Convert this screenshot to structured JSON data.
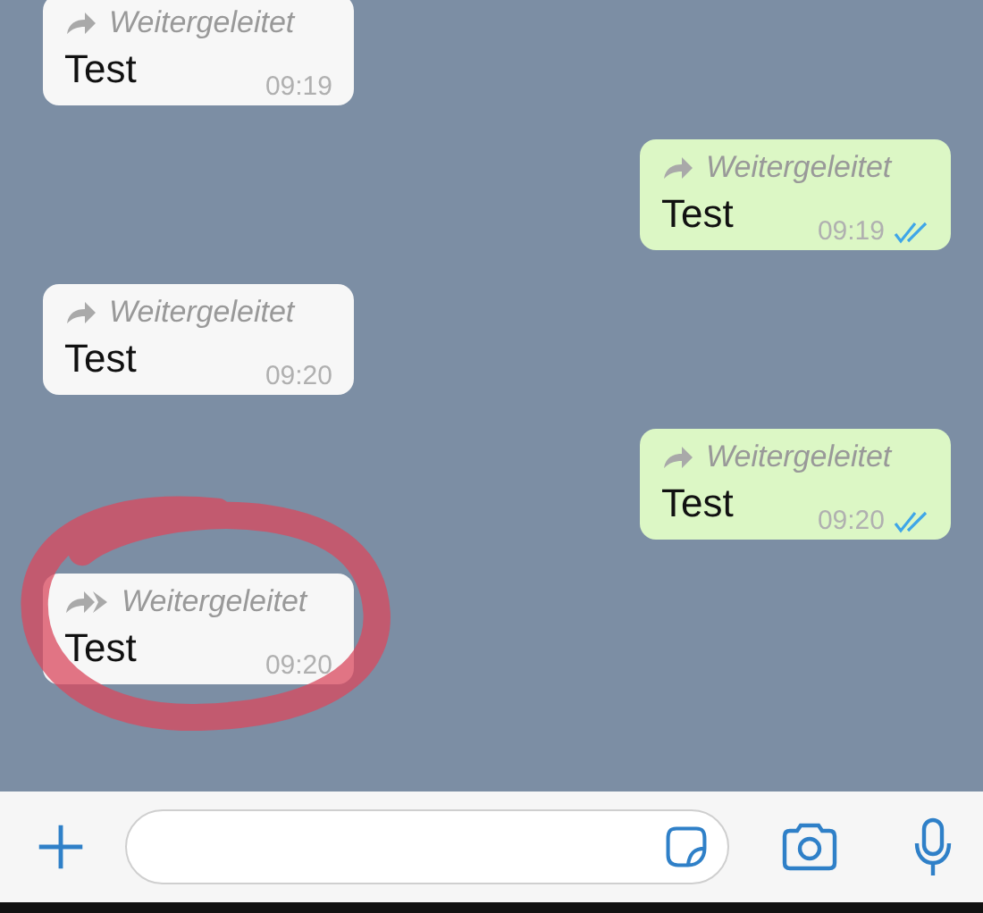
{
  "messages": [
    {
      "kind": "incoming",
      "forwarded_label": "Weitergeleitet",
      "frequently_forwarded": false,
      "text": "Test",
      "time": "09:19",
      "highlighted": false
    },
    {
      "kind": "outgoing",
      "forwarded_label": "Weitergeleitet",
      "frequently_forwarded": false,
      "text": "Test",
      "time": "09:19",
      "read": true,
      "highlighted": false
    },
    {
      "kind": "incoming",
      "forwarded_label": "Weitergeleitet",
      "frequently_forwarded": false,
      "text": "Test",
      "time": "09:20",
      "highlighted": false
    },
    {
      "kind": "outgoing",
      "forwarded_label": "Weitergeleitet",
      "frequently_forwarded": false,
      "text": "Test",
      "time": "09:20",
      "read": true,
      "highlighted": false
    },
    {
      "kind": "incoming",
      "forwarded_label": "Weitergeleitet",
      "frequently_forwarded": true,
      "text": "Test",
      "time": "09:20",
      "highlighted": true
    }
  ]
}
